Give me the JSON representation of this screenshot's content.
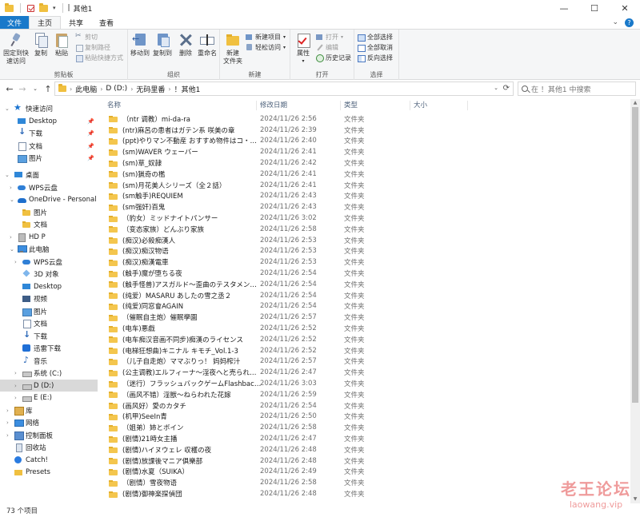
{
  "window": {
    "title": "其他1",
    "title_sep": "|",
    "controls": {
      "minimize": "—",
      "maximize": "☐",
      "close": "✕"
    }
  },
  "tabs": [
    {
      "label": "文件"
    },
    {
      "label": "主页"
    },
    {
      "label": "共享"
    },
    {
      "label": "查看"
    }
  ],
  "ribbon": {
    "clipboard": {
      "label": "剪贴板",
      "pin": "固定到快速访问",
      "copy": "复制",
      "paste": "粘贴",
      "cut": "剪切",
      "copy_path": "复制路径",
      "paste_shortcut": "粘贴快捷方式"
    },
    "organize": {
      "label": "组织",
      "move_to": "移动到",
      "copy_to": "复制到",
      "delete": "删除",
      "rename": "重命名"
    },
    "new": {
      "label": "新建",
      "new_folder": "新建\n文件夹",
      "new_item": "新建项目",
      "easy_access": "轻松访问"
    },
    "open": {
      "label": "打开",
      "properties": "属性",
      "open": "打开",
      "edit": "编辑",
      "history": "历史记录"
    },
    "select": {
      "label": "选择",
      "select_all": "全部选择",
      "select_none": "全部取消",
      "invert": "反向选择"
    }
  },
  "address": {
    "crumbs": [
      "此电脑",
      "D (D:)",
      "无码里番",
      "！其他1"
    ],
    "search_placeholder": "在 ！其他1 中搜索"
  },
  "nav": {
    "items": [
      {
        "label": "快速访问",
        "icon": "star-icon"
      },
      {
        "label": "Desktop",
        "icon": "desktop-icon"
      },
      {
        "label": "下载",
        "icon": "download-icon"
      },
      {
        "label": "文档",
        "icon": "document-icon"
      },
      {
        "label": "图片",
        "icon": "picture-icon"
      },
      {
        "label": "桌面",
        "icon": "desktop-icon"
      },
      {
        "label": "WPS云盘",
        "icon": "cloud-icon"
      },
      {
        "label": "OneDrive - Personal",
        "icon": "onedrive-icon"
      },
      {
        "label": "图片",
        "icon": "folder-icon"
      },
      {
        "label": "文档",
        "icon": "folder-icon"
      },
      {
        "label": "HD P",
        "icon": "hard-drive-icon"
      },
      {
        "label": "此电脑",
        "icon": "computer-icon"
      },
      {
        "label": "WPS云盘",
        "icon": "cloud-icon"
      },
      {
        "label": "3D 对象",
        "icon": "3d-objects-icon"
      },
      {
        "label": "Desktop",
        "icon": "desktop-icon"
      },
      {
        "label": "视频",
        "icon": "video-icon"
      },
      {
        "label": "图片",
        "icon": "picture-icon"
      },
      {
        "label": "文档",
        "icon": "document-icon"
      },
      {
        "label": "下载",
        "icon": "download-icon"
      },
      {
        "label": "迅雷下载",
        "icon": "xunlei-icon"
      },
      {
        "label": "音乐",
        "icon": "music-icon"
      },
      {
        "label": "系统 (C:)",
        "icon": "drive-icon"
      },
      {
        "label": "D (D:)",
        "icon": "drive-icon"
      },
      {
        "label": "E (E:)",
        "icon": "drive-icon"
      },
      {
        "label": "库",
        "icon": "library-icon"
      },
      {
        "label": "网络",
        "icon": "network-icon"
      },
      {
        "label": "控制面板",
        "icon": "control-panel-icon"
      },
      {
        "label": "回收站",
        "icon": "recycle-bin-icon"
      },
      {
        "label": "Catch!",
        "icon": "catch-icon"
      },
      {
        "label": "Presets",
        "icon": "folder-icon"
      }
    ]
  },
  "list": {
    "columns": {
      "name": "名称",
      "date": "修改日期",
      "type": "类型",
      "size": "大小"
    },
    "rows": [
      {
        "name": "（ntr 调教）mi-da-ra",
        "date": "2024/11/26 2:56",
        "type": "文件夹"
      },
      {
        "name": "(ntr)麻呂の患者はガテン系 咲美の章",
        "date": "2024/11/26 2:39",
        "type": "文件夹"
      },
      {
        "name": "(ppt)やりマン不動産 おすすめ物件はコ・チ・...",
        "date": "2024/11/26 2:40",
        "type": "文件夹"
      },
      {
        "name": "(sm)WAVER ウェーバー",
        "date": "2024/11/26 2:41",
        "type": "文件夹"
      },
      {
        "name": "(sm)草_奴隷",
        "date": "2024/11/26 2:42",
        "type": "文件夹"
      },
      {
        "name": "(sm)猟奇の檻",
        "date": "2024/11/26 2:41",
        "type": "文件夹"
      },
      {
        "name": "(sm)月花美人シリーズ（全２話）",
        "date": "2024/11/26 2:41",
        "type": "文件夹"
      },
      {
        "name": "(sm触手)REQUIEM",
        "date": "2024/11/26 2:43",
        "type": "文件夹"
      },
      {
        "name": "(sm强奸)百鬼",
        "date": "2024/11/26 2:43",
        "type": "文件夹"
      },
      {
        "name": "（豹女）ミッドナイトパンサー",
        "date": "2024/11/26 3:02",
        "type": "文件夹"
      },
      {
        "name": "（变态家族）どんぶり家族",
        "date": "2024/11/26 2:58",
        "type": "文件夹"
      },
      {
        "name": "(痴汉)必殺痴漢人",
        "date": "2024/11/26 2:53",
        "type": "文件夹"
      },
      {
        "name": "(痴汉)痴汉物语",
        "date": "2024/11/26 2:53",
        "type": "文件夹"
      },
      {
        "name": "(痴汉)痴漢電車",
        "date": "2024/11/26 2:53",
        "type": "文件夹"
      },
      {
        "name": "(触手)魔が堕ちる夜",
        "date": "2024/11/26 2:54",
        "type": "文件夹"
      },
      {
        "name": "(触手怪兽)アスガルド～歪曲のテスタメント～",
        "date": "2024/11/26 2:54",
        "type": "文件夹"
      },
      {
        "name": "(纯爱）MASARU あしたの雪之丞２",
        "date": "2024/11/26 2:54",
        "type": "文件夹"
      },
      {
        "name": "(纯爱)同窓會AGAIN",
        "date": "2024/11/26 2:54",
        "type": "文件夹"
      },
      {
        "name": "（催眠自主炮）催眠學園",
        "date": "2024/11/26 2:57",
        "type": "文件夹"
      },
      {
        "name": "(电车)悪戯",
        "date": "2024/11/26 2:52",
        "type": "文件夹"
      },
      {
        "name": "(电车痴汉音画不同步)痴漢のライセンス",
        "date": "2024/11/26 2:52",
        "type": "文件夹"
      },
      {
        "name": "(电梯狂想曲)キニナル キモチ_Vol.1-3",
        "date": "2024/11/26 2:52",
        "type": "文件夹"
      },
      {
        "name": "（儿子自走炮）ママぶりっ！ 妈妈榨汁",
        "date": "2024/11/26 2:57",
        "type": "文件夹"
      },
      {
        "name": "(公主调教)エルフィーナ～淫夜へと売られた王...",
        "date": "2024/11/26 2:47",
        "type": "文件夹"
      },
      {
        "name": "（迷行）フラッシュバックゲームFlashback G...",
        "date": "2024/11/26 3:03",
        "type": "文件夹"
      },
      {
        "name": "（画风不错）淫獣～ねらわれた花嫁",
        "date": "2024/11/26 2:59",
        "type": "文件夹"
      },
      {
        "name": "(画风好）愛のカタチ",
        "date": "2024/11/26 2:54",
        "type": "文件夹"
      },
      {
        "name": "(机甲)SeeIn青",
        "date": "2024/11/26 2:50",
        "type": "文件夹"
      },
      {
        "name": "（姐弟）姉とボイン",
        "date": "2024/11/26 2:58",
        "type": "文件夹"
      },
      {
        "name": "(剧情)21時女主播",
        "date": "2024/11/26 2:47",
        "type": "文件夹"
      },
      {
        "name": "(剧情)ハイヌウェレ 収穫の夜",
        "date": "2024/11/26 2:48",
        "type": "文件夹"
      },
      {
        "name": "(剧情)放課後マニア俱樂部",
        "date": "2024/11/26 2:48",
        "type": "文件夹"
      },
      {
        "name": "(剧情)水夏（SUIKA）",
        "date": "2024/11/26 2:49",
        "type": "文件夹"
      },
      {
        "name": "（剧情）雪夜物语",
        "date": "2024/11/26 2:58",
        "type": "文件夹"
      },
      {
        "name": "(剧情)御神楽探偵団",
        "date": "2024/11/26 2:48",
        "type": "文件夹"
      }
    ]
  },
  "status": {
    "count": "73 个项目"
  },
  "watermark": {
    "line1": "老王论坛",
    "line2": "laowang.vip"
  }
}
